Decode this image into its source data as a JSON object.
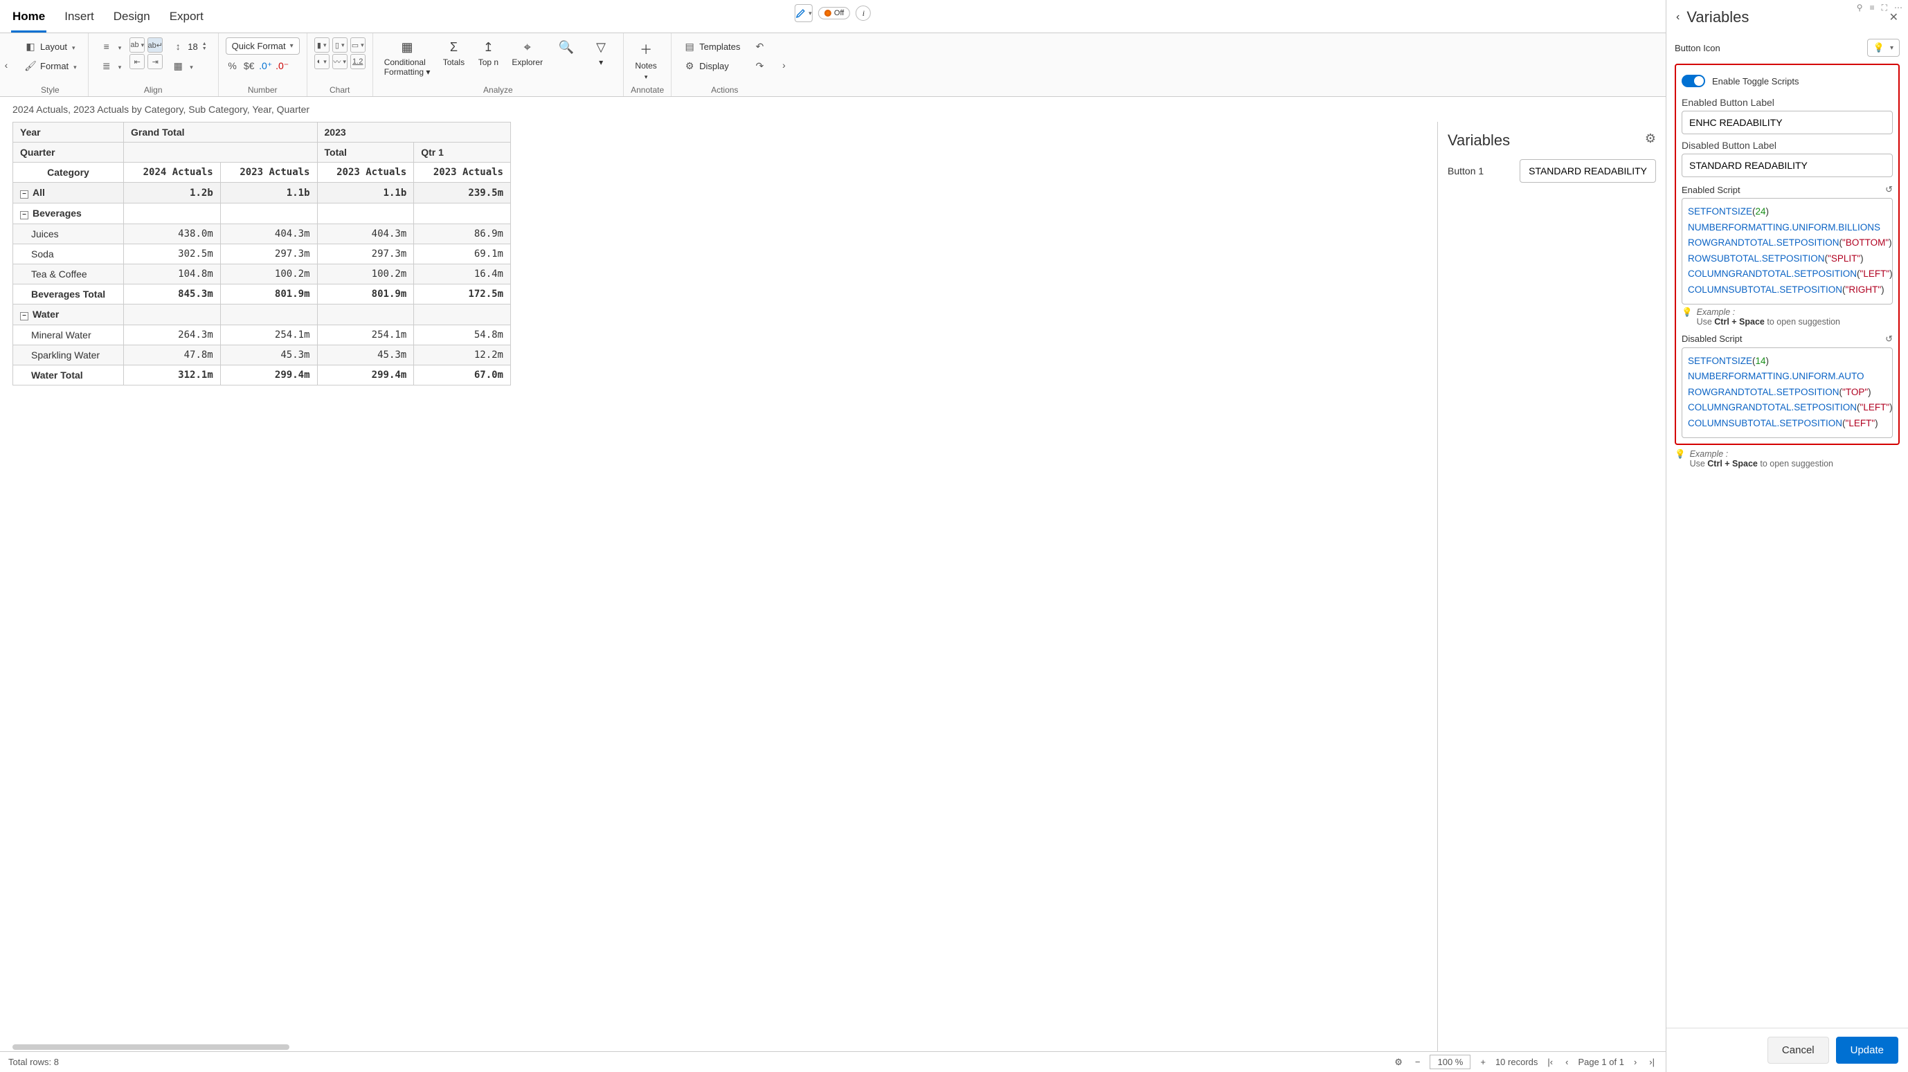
{
  "tabs": [
    "Home",
    "Insert",
    "Design",
    "Export"
  ],
  "top_icons": {
    "off_label": "Off"
  },
  "ribbon": {
    "style": {
      "layout": "Layout",
      "format": "Format",
      "label": "Style"
    },
    "align": {
      "font_size": "18",
      "label": "Align"
    },
    "number": {
      "quick": "Quick Format",
      "pct": "%",
      "cur": "$€",
      "dec_plus": ".0⁺",
      "dec_minus": ".0⁻",
      "label": "Number"
    },
    "chart": {
      "scale": "1.2",
      "label": "Chart"
    },
    "analyze": {
      "cond": "Conditional",
      "cond2": "Formatting",
      "totals": "Totals",
      "topn": "Top n",
      "explorer": "Explorer",
      "label": "Analyze"
    },
    "annotate": {
      "notes": "Notes",
      "label": "Annotate"
    },
    "actions": {
      "templates": "Templates",
      "display": "Display",
      "label": "Actions"
    }
  },
  "doc_title": "2024 Actuals, 2023 Actuals by Category, Sub Category, Year, Quarter",
  "table": {
    "col_year": "Year",
    "col_quarter": "Quarter",
    "col_category": "Category",
    "grand_total": "Grand Total",
    "y2023": "2023",
    "total": "Total",
    "qtr1": "Qtr 1",
    "h_2024": "2024 Actuals",
    "h_2023": "2023 Actuals",
    "rows": {
      "all": {
        "label": "All",
        "v": [
          "1.2b",
          "1.1b",
          "1.1b",
          "239.5m"
        ]
      },
      "beverages": "Beverages",
      "juices": {
        "label": "Juices",
        "v": [
          "438.0m",
          "404.3m",
          "404.3m",
          "86.9m"
        ]
      },
      "soda": {
        "label": "Soda",
        "v": [
          "302.5m",
          "297.3m",
          "297.3m",
          "69.1m"
        ]
      },
      "tea": {
        "label": "Tea & Coffee",
        "v": [
          "104.8m",
          "100.2m",
          "100.2m",
          "16.4m"
        ]
      },
      "bev_total": {
        "label": "Beverages Total",
        "v": [
          "845.3m",
          "801.9m",
          "801.9m",
          "172.5m"
        ]
      },
      "water": "Water",
      "mineral": {
        "label": "Mineral Water",
        "v": [
          "264.3m",
          "254.1m",
          "254.1m",
          "54.8m"
        ]
      },
      "sparkling": {
        "label": "Sparkling Water",
        "v": [
          "47.8m",
          "45.3m",
          "45.3m",
          "12.2m"
        ]
      },
      "water_total": {
        "label": "Water Total",
        "v": [
          "312.1m",
          "299.4m",
          "299.4m",
          "67.0m"
        ]
      }
    }
  },
  "vars_mid": {
    "title": "Variables",
    "btn1": "Button 1",
    "btn1_label": "STANDARD READABILITY"
  },
  "statusbar": {
    "total_rows": "Total rows: 8",
    "zoom": "100 %",
    "records": "10 records",
    "page": "Page 1 of 1"
  },
  "side": {
    "title": "Variables",
    "btn_icon": "Button Icon",
    "enable_toggle": "Enable Toggle Scripts",
    "enabled_label": "Enabled Button Label",
    "enabled_val": "ENHC READABILITY",
    "disabled_label": "Disabled Button Label",
    "disabled_val": "STANDARD READABILITY",
    "enabled_script": "Enabled Script",
    "disabled_script": "Disabled Script",
    "example": "Example :",
    "hint_pre": "Use ",
    "hint_key": "Ctrl + Space",
    "hint_post": " to open suggestion",
    "cancel": "Cancel",
    "update": "Update",
    "script1": [
      {
        "t": "fn",
        "s": "SETFONTSIZE"
      },
      {
        "t": "pn",
        "s": "("
      },
      {
        "t": "num",
        "s": "24"
      },
      {
        "t": "pn",
        "s": ")\n"
      },
      {
        "t": "fn",
        "s": "NUMBERFORMATTING.UNIFORM.BILLIONS"
      },
      {
        "t": "pn",
        "s": "\n"
      },
      {
        "t": "fn",
        "s": "ROWGRANDTOTAL.SETPOSITION"
      },
      {
        "t": "pn",
        "s": "("
      },
      {
        "t": "str",
        "s": "\"BOTTOM\""
      },
      {
        "t": "pn",
        "s": ")\n"
      },
      {
        "t": "fn",
        "s": "ROWSUBTOTAL.SETPOSITION"
      },
      {
        "t": "pn",
        "s": "("
      },
      {
        "t": "str",
        "s": "\"SPLIT\""
      },
      {
        "t": "pn",
        "s": ")\n"
      },
      {
        "t": "fn",
        "s": "COLUMNGRANDTOTAL.SETPOSITION"
      },
      {
        "t": "pn",
        "s": "("
      },
      {
        "t": "str",
        "s": "\"LEFT\""
      },
      {
        "t": "pn",
        "s": ")\n"
      },
      {
        "t": "fn",
        "s": "COLUMNSUBTOTAL.SETPOSITION"
      },
      {
        "t": "pn",
        "s": "("
      },
      {
        "t": "str",
        "s": "\"RIGHT\""
      },
      {
        "t": "pn",
        "s": ")"
      }
    ],
    "script2": [
      {
        "t": "fn",
        "s": "SETFONTSIZE"
      },
      {
        "t": "pn",
        "s": "("
      },
      {
        "t": "num",
        "s": "14"
      },
      {
        "t": "pn",
        "s": ")\n"
      },
      {
        "t": "fn",
        "s": "NUMBERFORMATTING.UNIFORM.AUTO"
      },
      {
        "t": "pn",
        "s": "\n"
      },
      {
        "t": "fn",
        "s": "ROWGRANDTOTAL.SETPOSITION"
      },
      {
        "t": "pn",
        "s": "("
      },
      {
        "t": "str",
        "s": "\"TOP\""
      },
      {
        "t": "pn",
        "s": ")\n"
      },
      {
        "t": "fn",
        "s": "COLUMNGRANDTOTAL.SETPOSITION"
      },
      {
        "t": "pn",
        "s": "("
      },
      {
        "t": "str",
        "s": "\"LEFT\""
      },
      {
        "t": "pn",
        "s": ")\n"
      },
      {
        "t": "fn",
        "s": "COLUMNSUBTOTAL.SETPOSITION"
      },
      {
        "t": "pn",
        "s": "("
      },
      {
        "t": "str",
        "s": "\"LEFT\""
      },
      {
        "t": "pn",
        "s": ")"
      }
    ]
  }
}
